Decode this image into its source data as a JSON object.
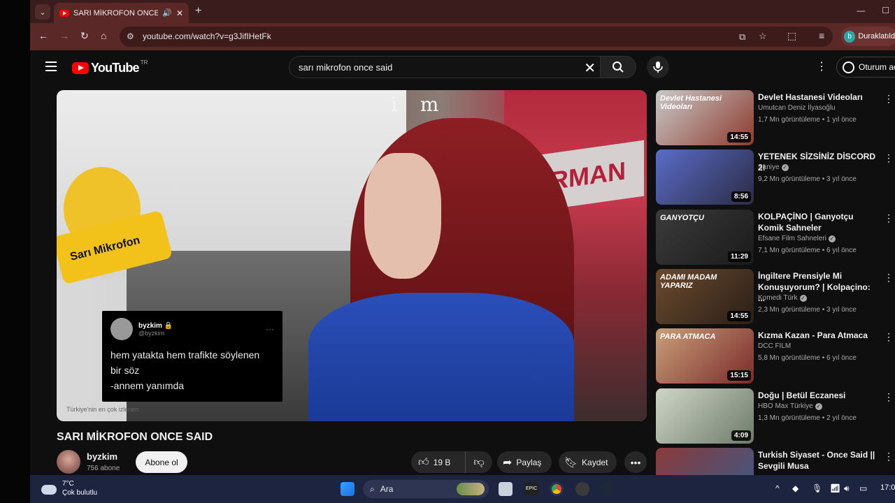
{
  "browser": {
    "tab_title": "SARI MİKROFON ONCE SAİD",
    "tab_audio_icon": "speaker-icon",
    "url": "youtube.com/watch?v=g3JifIHetFk",
    "profile_initial": "b",
    "profile_label": "Duraklatıldı"
  },
  "youtube": {
    "logo_text": "YouTube",
    "country_code": "TR",
    "search_query": "sarı mikrofon once said",
    "sign_in_label": "Oturum aç"
  },
  "video": {
    "watermark": "i m",
    "tweet": {
      "name": "byzkim",
      "handle": "@byzkim",
      "line1": "hem yatakta hem trafikte söylenen",
      "line2": "bir söz",
      "line3": "-annem yanımda"
    },
    "mic_label": "Sarı Mikrofon",
    "caption": "Türkiye'nin en çok izlenen",
    "title": "SARI MİKROFON ONCE SAID",
    "channel": "byzkim",
    "subscribers": "756 abone",
    "subscribe_label": "Abone ol",
    "likes": "19 B",
    "share_label": "Paylaş",
    "save_label": "Kaydet"
  },
  "recommendations": [
    {
      "title": "Devlet Hastanesi Videoları",
      "channel": "Umutcan Deniz İlyasoğlu",
      "verified": false,
      "meta": "1,7 Mn görüntüleme • 1 yıl önce",
      "duration": "14:55",
      "thumb_text": "Devlet Hastanesi Videoları",
      "colors": [
        "#c9c9c9",
        "#8d3b2e"
      ]
    },
    {
      "title": "YETENEK SİZSİNİZ DİSCORD 2!",
      "channel": "Saniye",
      "verified": true,
      "meta": "9,2 Mn görüntüleme • 3 yıl önce",
      "duration": "8:56",
      "thumb_text": "",
      "colors": [
        "#5a6cc8",
        "#2b2b44"
      ]
    },
    {
      "title": "KOLPAÇİNO | Ganyotçu Komik Sahneler",
      "channel": "Efsane Film Sahneleri",
      "verified": true,
      "meta": "7,1 Mn görüntüleme • 6 yıl önce",
      "duration": "11:29",
      "thumb_text": "GANYOTÇU",
      "colors": [
        "#3b3b3b",
        "#1a1a1a"
      ]
    },
    {
      "title": "İngiltere Prensiyle Mi Konuşuyorum? | Kolpaçino: ...",
      "channel": "Komedi Türk",
      "verified": true,
      "meta": "2,3 Mn görüntüleme • 3 yıl önce",
      "duration": "14:55",
      "thumb_text": "ADAMI MADAM YAPARIZ",
      "colors": [
        "#6b4a2e",
        "#2a1f18"
      ]
    },
    {
      "title": "Kızma Kazan - Para Atmaca",
      "channel": "DCC FILM",
      "verified": false,
      "meta": "5,8 Mn görüntüleme • 6 yıl önce",
      "duration": "15:15",
      "thumb_text": "PARA ATMACA",
      "colors": [
        "#c9a07a",
        "#7a2a2a"
      ]
    },
    {
      "title": "Doğu | Betül Eczanesi",
      "channel": "HBO Max Türkiye",
      "verified": true,
      "meta": "1,3 Mn görüntüleme • 2 yıl önce",
      "duration": "4:09",
      "thumb_text": "",
      "colors": [
        "#cfd6c8",
        "#6d7a6a"
      ]
    },
    {
      "title": "Turkish Siyaset - Once Said || Sevgili Musa",
      "channel": "",
      "verified": false,
      "meta": "",
      "duration": "",
      "thumb_text": "",
      "colors": [
        "#8a3a3a",
        "#3a5a8a"
      ]
    }
  ],
  "taskbar": {
    "temperature": "7°C",
    "weather": "Çok bulutlu",
    "search_label": "Ara",
    "time": "17:03"
  }
}
